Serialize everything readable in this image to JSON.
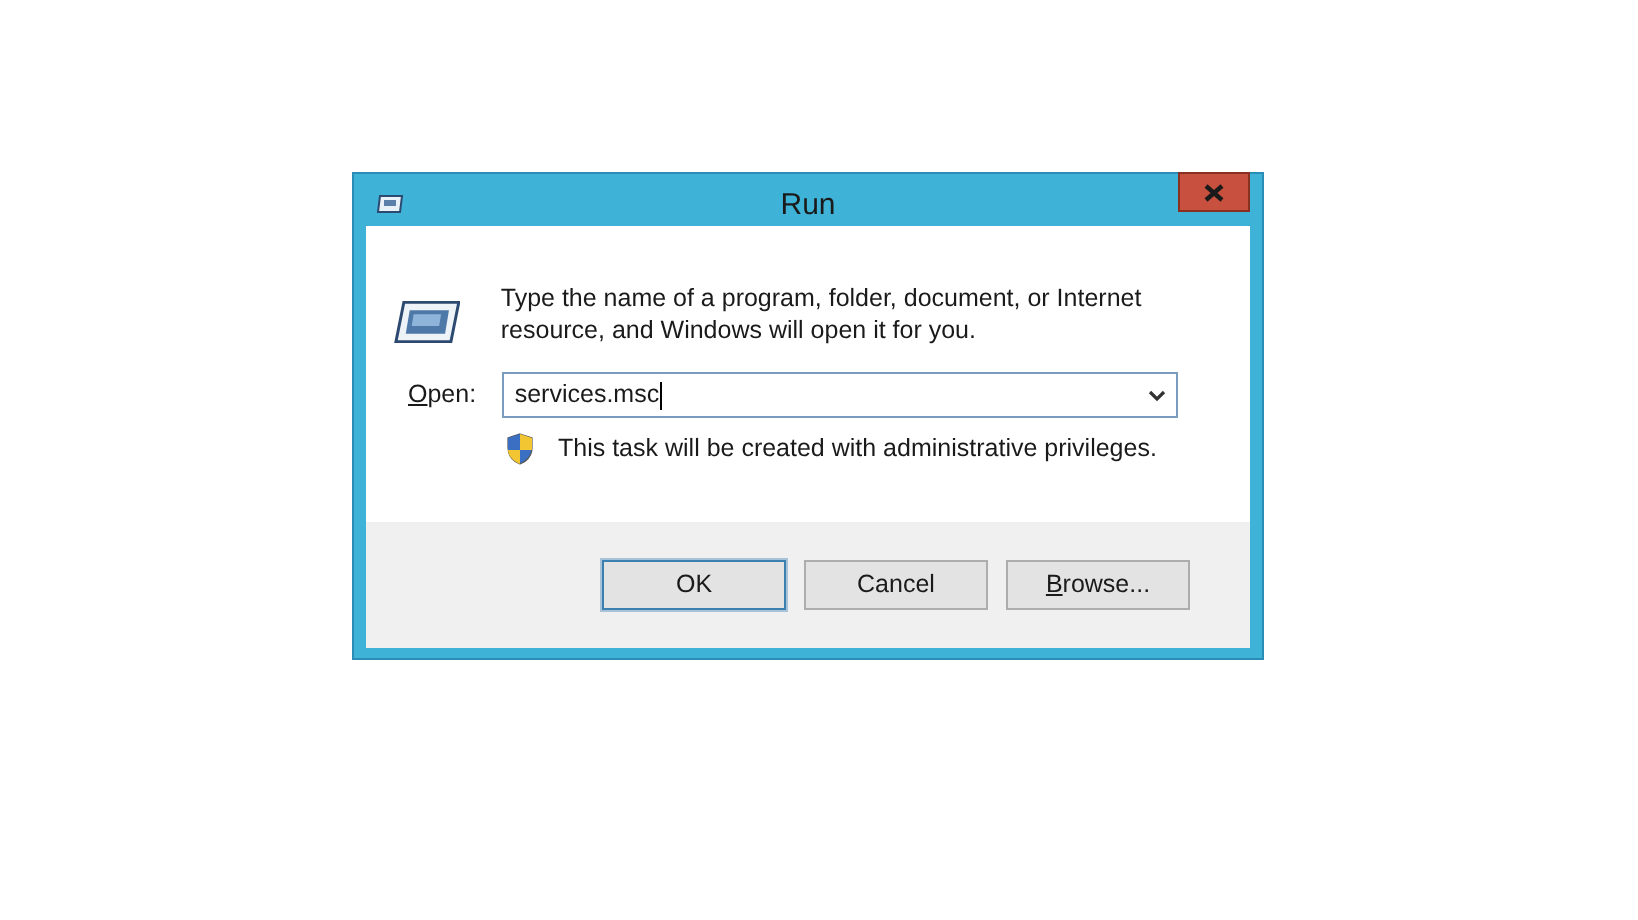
{
  "window": {
    "title": "Run"
  },
  "description": "Type the name of a program, folder, document, or Internet resource, and Windows will open it for you.",
  "open_field": {
    "label": "Open:",
    "label_mnemonic": true,
    "value": "services.msc"
  },
  "admin_note": "This task will be created with administrative privileges.",
  "buttons": [
    {
      "label": "OK",
      "default": true,
      "mnemonic": false
    },
    {
      "label": "Cancel",
      "default": false,
      "mnemonic": false
    },
    {
      "label": "Browse...",
      "default": false,
      "mnemonic": true
    }
  ]
}
